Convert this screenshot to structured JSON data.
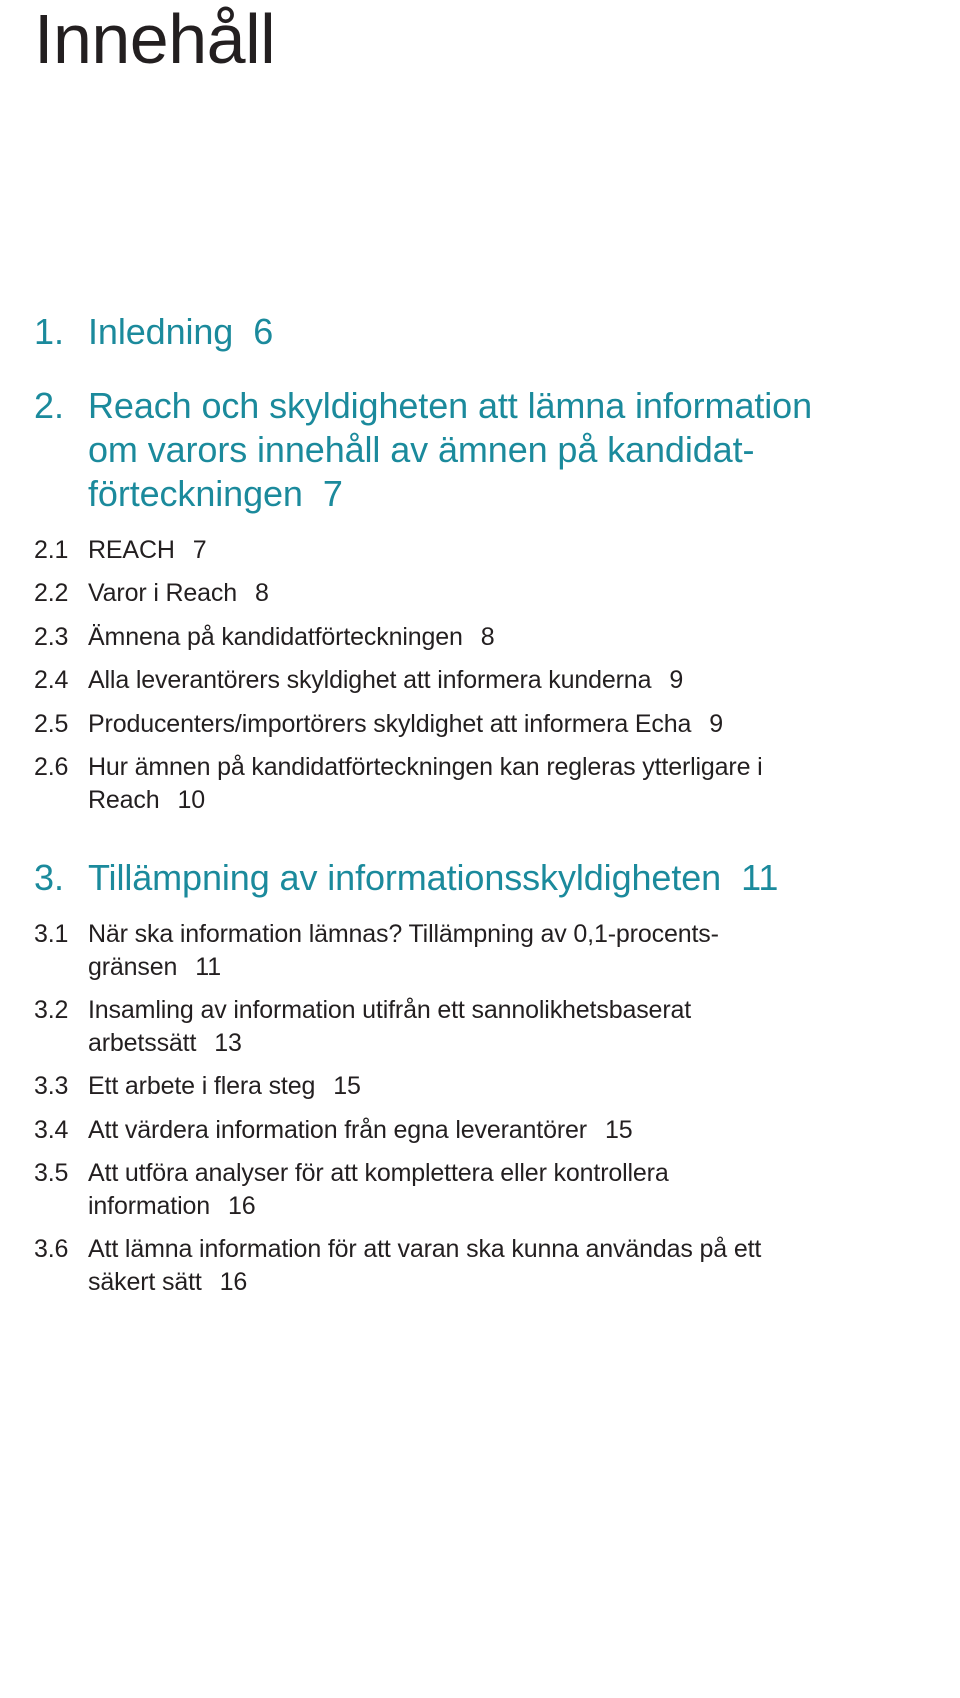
{
  "document": {
    "title": "Innehåll",
    "colors": {
      "heading_teal": "#1b8a9c",
      "body_text": "#231f20",
      "background": "#ffffff"
    }
  },
  "toc": {
    "entries": [
      {
        "number": "1.",
        "title": "Inledning",
        "page": "6",
        "level": "chapter"
      },
      {
        "number": "2.",
        "line1": "Reach och skyldigheten att lämna information",
        "line2": "om varors innehåll av ämnen på kandidat-",
        "line3": "förteckningen",
        "page": "7",
        "level": "chapter"
      },
      {
        "number": "2.1",
        "title": "REACH",
        "page": "7",
        "level": "section"
      },
      {
        "number": "2.2",
        "title": "Varor i Reach",
        "page": "8",
        "level": "section"
      },
      {
        "number": "2.3",
        "title": "Ämnena på kandidatförteckningen",
        "page": "8",
        "level": "section"
      },
      {
        "number": "2.4",
        "title": "Alla leverantörers skyldighet att informera kunderna",
        "page": "9",
        "level": "section"
      },
      {
        "number": "2.5",
        "title": "Producenters/importörers skyldighet att informera Echa",
        "page": "9",
        "level": "section"
      },
      {
        "number": "2.6",
        "line1": "Hur ämnen på kandidatförteckningen kan regleras ytterligare i",
        "line2": "Reach",
        "page": "10",
        "level": "section"
      },
      {
        "number": "3.",
        "title": "Tillämpning av informationsskyldigheten",
        "page": "11",
        "level": "chapter"
      },
      {
        "number": "3.1",
        "line1": "När ska information lämnas? Tillämpning av 0,1-procents-",
        "line2": "gränsen",
        "page": "11",
        "level": "section"
      },
      {
        "number": "3.2",
        "line1": "Insamling av information utifrån ett sannolikhetsbaserat",
        "line2": "arbetssätt",
        "page": "13",
        "level": "section"
      },
      {
        "number": "3.3",
        "title": "Ett arbete i flera steg",
        "page": "15",
        "level": "section"
      },
      {
        "number": "3.4",
        "title": "Att värdera information från egna leverantörer",
        "page": "15",
        "level": "section"
      },
      {
        "number": "3.5",
        "line1": "Att utföra analyser för att komplettera eller kontrollera",
        "line2": "information",
        "page": "16",
        "level": "section"
      },
      {
        "number": "3.6",
        "line1": "Att lämna information för att varan ska kunna användas på ett",
        "line2": "säkert sätt",
        "page": "16",
        "level": "section"
      }
    ]
  }
}
